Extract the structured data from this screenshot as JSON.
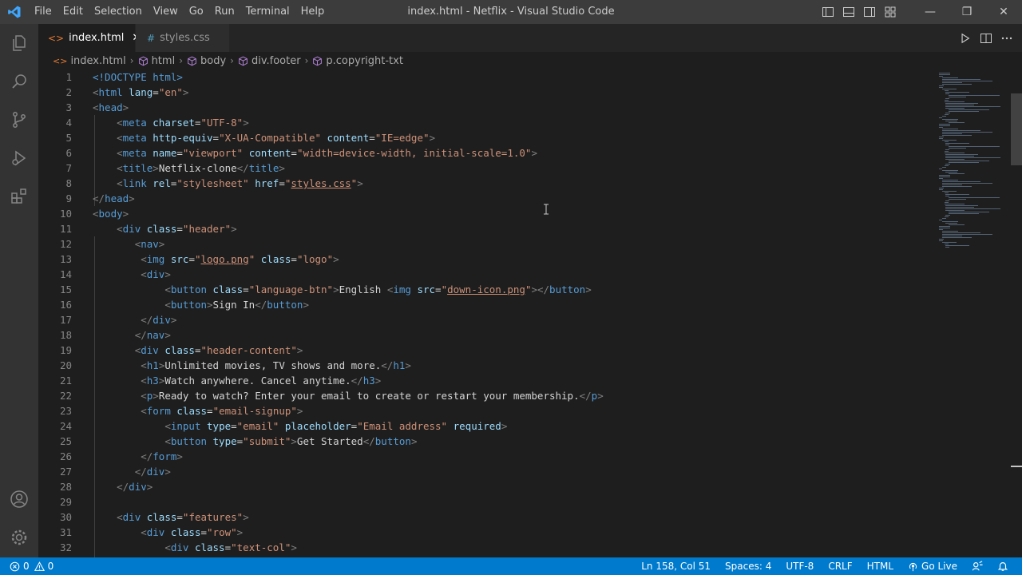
{
  "window": {
    "title": "index.html - Netflix - Visual Studio Code",
    "menu": [
      "File",
      "Edit",
      "Selection",
      "View",
      "Go",
      "Run",
      "Terminal",
      "Help"
    ],
    "controls": {
      "minimize": "—",
      "restore": "❐",
      "close": "✕"
    }
  },
  "activity_bar": [
    "explorer-icon",
    "search-icon",
    "source-control-icon",
    "run-debug-icon",
    "extensions-icon",
    "accounts-icon",
    "manage-gear-icon"
  ],
  "tabs": [
    {
      "label": "index.html",
      "icon": "<>",
      "active": true,
      "close": "✕"
    },
    {
      "label": "styles.css",
      "icon": "#",
      "active": false
    }
  ],
  "breadcrumb": [
    "index.html",
    "html",
    "body",
    "div.footer",
    "p.copyright-txt"
  ],
  "status": {
    "errors": "0",
    "warnings": "0",
    "position": "Ln 158, Col 51",
    "spaces": "Spaces: 4",
    "encoding": "UTF-8",
    "eol": "CRLF",
    "language": "HTML",
    "live": "Go Live"
  },
  "colors": {
    "accent": "#007acc",
    "tag": "#569cd6",
    "attribute": "#9cdcfe",
    "string": "#ce9178",
    "text": "#d4d4d4"
  },
  "editor": {
    "lines": [
      [
        [
          "doc",
          "<!DOCTYPE "
        ],
        [
          "tag",
          "html"
        ],
        [
          "doc",
          ">"
        ]
      ],
      [
        [
          "brk",
          "<"
        ],
        [
          "tag",
          "html"
        ],
        [
          "t",
          " "
        ],
        [
          "attr",
          "lang"
        ],
        [
          "t",
          "="
        ],
        [
          "str",
          "\"en\""
        ],
        [
          "brk",
          ">"
        ]
      ],
      [
        [
          "brk",
          "<"
        ],
        [
          "tag",
          "head"
        ],
        [
          "brk",
          ">"
        ]
      ],
      [
        [
          "t",
          "    "
        ],
        [
          "brk",
          "<"
        ],
        [
          "tag",
          "meta"
        ],
        [
          "t",
          " "
        ],
        [
          "attr",
          "charset"
        ],
        [
          "t",
          "="
        ],
        [
          "str",
          "\"UTF-8\""
        ],
        [
          "brk",
          ">"
        ]
      ],
      [
        [
          "t",
          "    "
        ],
        [
          "brk",
          "<"
        ],
        [
          "tag",
          "meta"
        ],
        [
          "t",
          " "
        ],
        [
          "attr",
          "http-equiv"
        ],
        [
          "t",
          "="
        ],
        [
          "str",
          "\"X-UA-Compatible\""
        ],
        [
          "t",
          " "
        ],
        [
          "attr",
          "content"
        ],
        [
          "t",
          "="
        ],
        [
          "str",
          "\"IE=edge\""
        ],
        [
          "brk",
          ">"
        ]
      ],
      [
        [
          "t",
          "    "
        ],
        [
          "brk",
          "<"
        ],
        [
          "tag",
          "meta"
        ],
        [
          "t",
          " "
        ],
        [
          "attr",
          "name"
        ],
        [
          "t",
          "="
        ],
        [
          "str",
          "\"viewport\""
        ],
        [
          "t",
          " "
        ],
        [
          "attr",
          "content"
        ],
        [
          "t",
          "="
        ],
        [
          "str",
          "\"width=device-width, initial-scale=1.0\""
        ],
        [
          "brk",
          ">"
        ]
      ],
      [
        [
          "t",
          "    "
        ],
        [
          "brk",
          "<"
        ],
        [
          "tag",
          "title"
        ],
        [
          "brk",
          ">"
        ],
        [
          "t",
          "Netflix-clone"
        ],
        [
          "brk",
          "</"
        ],
        [
          "tag",
          "title"
        ],
        [
          "brk",
          ">"
        ]
      ],
      [
        [
          "t",
          "    "
        ],
        [
          "brk",
          "<"
        ],
        [
          "tag",
          "link"
        ],
        [
          "t",
          " "
        ],
        [
          "attr",
          "rel"
        ],
        [
          "t",
          "="
        ],
        [
          "str",
          "\"stylesheet\""
        ],
        [
          "t",
          " "
        ],
        [
          "attr",
          "href"
        ],
        [
          "t",
          "="
        ],
        [
          "str",
          "\""
        ],
        [
          "link",
          "styles.css"
        ],
        [
          "str",
          "\""
        ],
        [
          "brk",
          ">"
        ]
      ],
      [
        [
          "brk",
          "</"
        ],
        [
          "tag",
          "head"
        ],
        [
          "brk",
          ">"
        ]
      ],
      [
        [
          "brk",
          "<"
        ],
        [
          "tag",
          "body"
        ],
        [
          "brk",
          ">"
        ]
      ],
      [
        [
          "t",
          "    "
        ],
        [
          "brk",
          "<"
        ],
        [
          "tag",
          "div"
        ],
        [
          "t",
          " "
        ],
        [
          "attr",
          "class"
        ],
        [
          "t",
          "="
        ],
        [
          "str",
          "\"header\""
        ],
        [
          "brk",
          ">"
        ]
      ],
      [
        [
          "t",
          "       "
        ],
        [
          "brk",
          "<"
        ],
        [
          "tag",
          "nav"
        ],
        [
          "brk",
          ">"
        ]
      ],
      [
        [
          "t",
          "        "
        ],
        [
          "brk",
          "<"
        ],
        [
          "tag",
          "img"
        ],
        [
          "t",
          " "
        ],
        [
          "attr",
          "src"
        ],
        [
          "t",
          "="
        ],
        [
          "str",
          "\""
        ],
        [
          "link",
          "logo.png"
        ],
        [
          "str",
          "\""
        ],
        [
          "t",
          " "
        ],
        [
          "attr",
          "class"
        ],
        [
          "t",
          "="
        ],
        [
          "str",
          "\"logo\""
        ],
        [
          "brk",
          ">"
        ]
      ],
      [
        [
          "t",
          "        "
        ],
        [
          "brk",
          "<"
        ],
        [
          "tag",
          "div"
        ],
        [
          "brk",
          ">"
        ]
      ],
      [
        [
          "t",
          "            "
        ],
        [
          "brk",
          "<"
        ],
        [
          "tag",
          "button"
        ],
        [
          "t",
          " "
        ],
        [
          "attr",
          "class"
        ],
        [
          "t",
          "="
        ],
        [
          "str",
          "\"language-btn\""
        ],
        [
          "brk",
          ">"
        ],
        [
          "t",
          "English "
        ],
        [
          "brk",
          "<"
        ],
        [
          "tag",
          "img"
        ],
        [
          "t",
          " "
        ],
        [
          "attr",
          "src"
        ],
        [
          "t",
          "="
        ],
        [
          "str",
          "\""
        ],
        [
          "link",
          "down-icon.png"
        ],
        [
          "str",
          "\""
        ],
        [
          "brk",
          "></"
        ],
        [
          "tag",
          "button"
        ],
        [
          "brk",
          ">"
        ]
      ],
      [
        [
          "t",
          "            "
        ],
        [
          "brk",
          "<"
        ],
        [
          "tag",
          "button"
        ],
        [
          "brk",
          ">"
        ],
        [
          "t",
          "Sign In"
        ],
        [
          "brk",
          "</"
        ],
        [
          "tag",
          "button"
        ],
        [
          "brk",
          ">"
        ]
      ],
      [
        [
          "t",
          "        "
        ],
        [
          "brk",
          "</"
        ],
        [
          "tag",
          "div"
        ],
        [
          "brk",
          ">"
        ]
      ],
      [
        [
          "t",
          "       "
        ],
        [
          "brk",
          "</"
        ],
        [
          "tag",
          "nav"
        ],
        [
          "brk",
          ">"
        ]
      ],
      [
        [
          "t",
          "       "
        ],
        [
          "brk",
          "<"
        ],
        [
          "tag",
          "div"
        ],
        [
          "t",
          " "
        ],
        [
          "attr",
          "class"
        ],
        [
          "t",
          "="
        ],
        [
          "str",
          "\"header-content\""
        ],
        [
          "brk",
          ">"
        ]
      ],
      [
        [
          "t",
          "        "
        ],
        [
          "brk",
          "<"
        ],
        [
          "tag",
          "h1"
        ],
        [
          "brk",
          ">"
        ],
        [
          "t",
          "Unlimited movies, TV shows and more."
        ],
        [
          "brk",
          "</"
        ],
        [
          "tag",
          "h1"
        ],
        [
          "brk",
          ">"
        ]
      ],
      [
        [
          "t",
          "        "
        ],
        [
          "brk",
          "<"
        ],
        [
          "tag",
          "h3"
        ],
        [
          "brk",
          ">"
        ],
        [
          "t",
          "Watch anywhere. Cancel anytime."
        ],
        [
          "brk",
          "</"
        ],
        [
          "tag",
          "h3"
        ],
        [
          "brk",
          ">"
        ]
      ],
      [
        [
          "t",
          "        "
        ],
        [
          "brk",
          "<"
        ],
        [
          "tag",
          "p"
        ],
        [
          "brk",
          ">"
        ],
        [
          "t",
          "Ready to watch? Enter your email to create or restart your membership."
        ],
        [
          "brk",
          "</"
        ],
        [
          "tag",
          "p"
        ],
        [
          "brk",
          ">"
        ]
      ],
      [
        [
          "t",
          "        "
        ],
        [
          "brk",
          "<"
        ],
        [
          "tag",
          "form"
        ],
        [
          "t",
          " "
        ],
        [
          "attr",
          "class"
        ],
        [
          "t",
          "="
        ],
        [
          "str",
          "\"email-signup\""
        ],
        [
          "brk",
          ">"
        ]
      ],
      [
        [
          "t",
          "            "
        ],
        [
          "brk",
          "<"
        ],
        [
          "tag",
          "input"
        ],
        [
          "t",
          " "
        ],
        [
          "attr",
          "type"
        ],
        [
          "t",
          "="
        ],
        [
          "str",
          "\"email\""
        ],
        [
          "t",
          " "
        ],
        [
          "attr",
          "placeholder"
        ],
        [
          "t",
          "="
        ],
        [
          "str",
          "\"Email address\""
        ],
        [
          "t",
          " "
        ],
        [
          "attr",
          "required"
        ],
        [
          "brk",
          ">"
        ]
      ],
      [
        [
          "t",
          "            "
        ],
        [
          "brk",
          "<"
        ],
        [
          "tag",
          "button"
        ],
        [
          "t",
          " "
        ],
        [
          "attr",
          "type"
        ],
        [
          "t",
          "="
        ],
        [
          "str",
          "\"submit\""
        ],
        [
          "brk",
          ">"
        ],
        [
          "t",
          "Get Started"
        ],
        [
          "brk",
          "</"
        ],
        [
          "tag",
          "button"
        ],
        [
          "brk",
          ">"
        ]
      ],
      [
        [
          "t",
          "        "
        ],
        [
          "brk",
          "</"
        ],
        [
          "tag",
          "form"
        ],
        [
          "brk",
          ">"
        ]
      ],
      [
        [
          "t",
          "       "
        ],
        [
          "brk",
          "</"
        ],
        [
          "tag",
          "div"
        ],
        [
          "brk",
          ">"
        ]
      ],
      [
        [
          "t",
          "    "
        ],
        [
          "brk",
          "</"
        ],
        [
          "tag",
          "div"
        ],
        [
          "brk",
          ">"
        ]
      ],
      [],
      [
        [
          "t",
          "    "
        ],
        [
          "brk",
          "<"
        ],
        [
          "tag",
          "div"
        ],
        [
          "t",
          " "
        ],
        [
          "attr",
          "class"
        ],
        [
          "t",
          "="
        ],
        [
          "str",
          "\"features\""
        ],
        [
          "brk",
          ">"
        ]
      ],
      [
        [
          "t",
          "        "
        ],
        [
          "brk",
          "<"
        ],
        [
          "tag",
          "div"
        ],
        [
          "t",
          " "
        ],
        [
          "attr",
          "class"
        ],
        [
          "t",
          "="
        ],
        [
          "str",
          "\"row\""
        ],
        [
          "brk",
          ">"
        ]
      ],
      [
        [
          "t",
          "            "
        ],
        [
          "brk",
          "<"
        ],
        [
          "tag",
          "div"
        ],
        [
          "t",
          " "
        ],
        [
          "attr",
          "class"
        ],
        [
          "t",
          "="
        ],
        [
          "str",
          "\"text-col\""
        ],
        [
          "brk",
          ">"
        ]
      ]
    ]
  }
}
